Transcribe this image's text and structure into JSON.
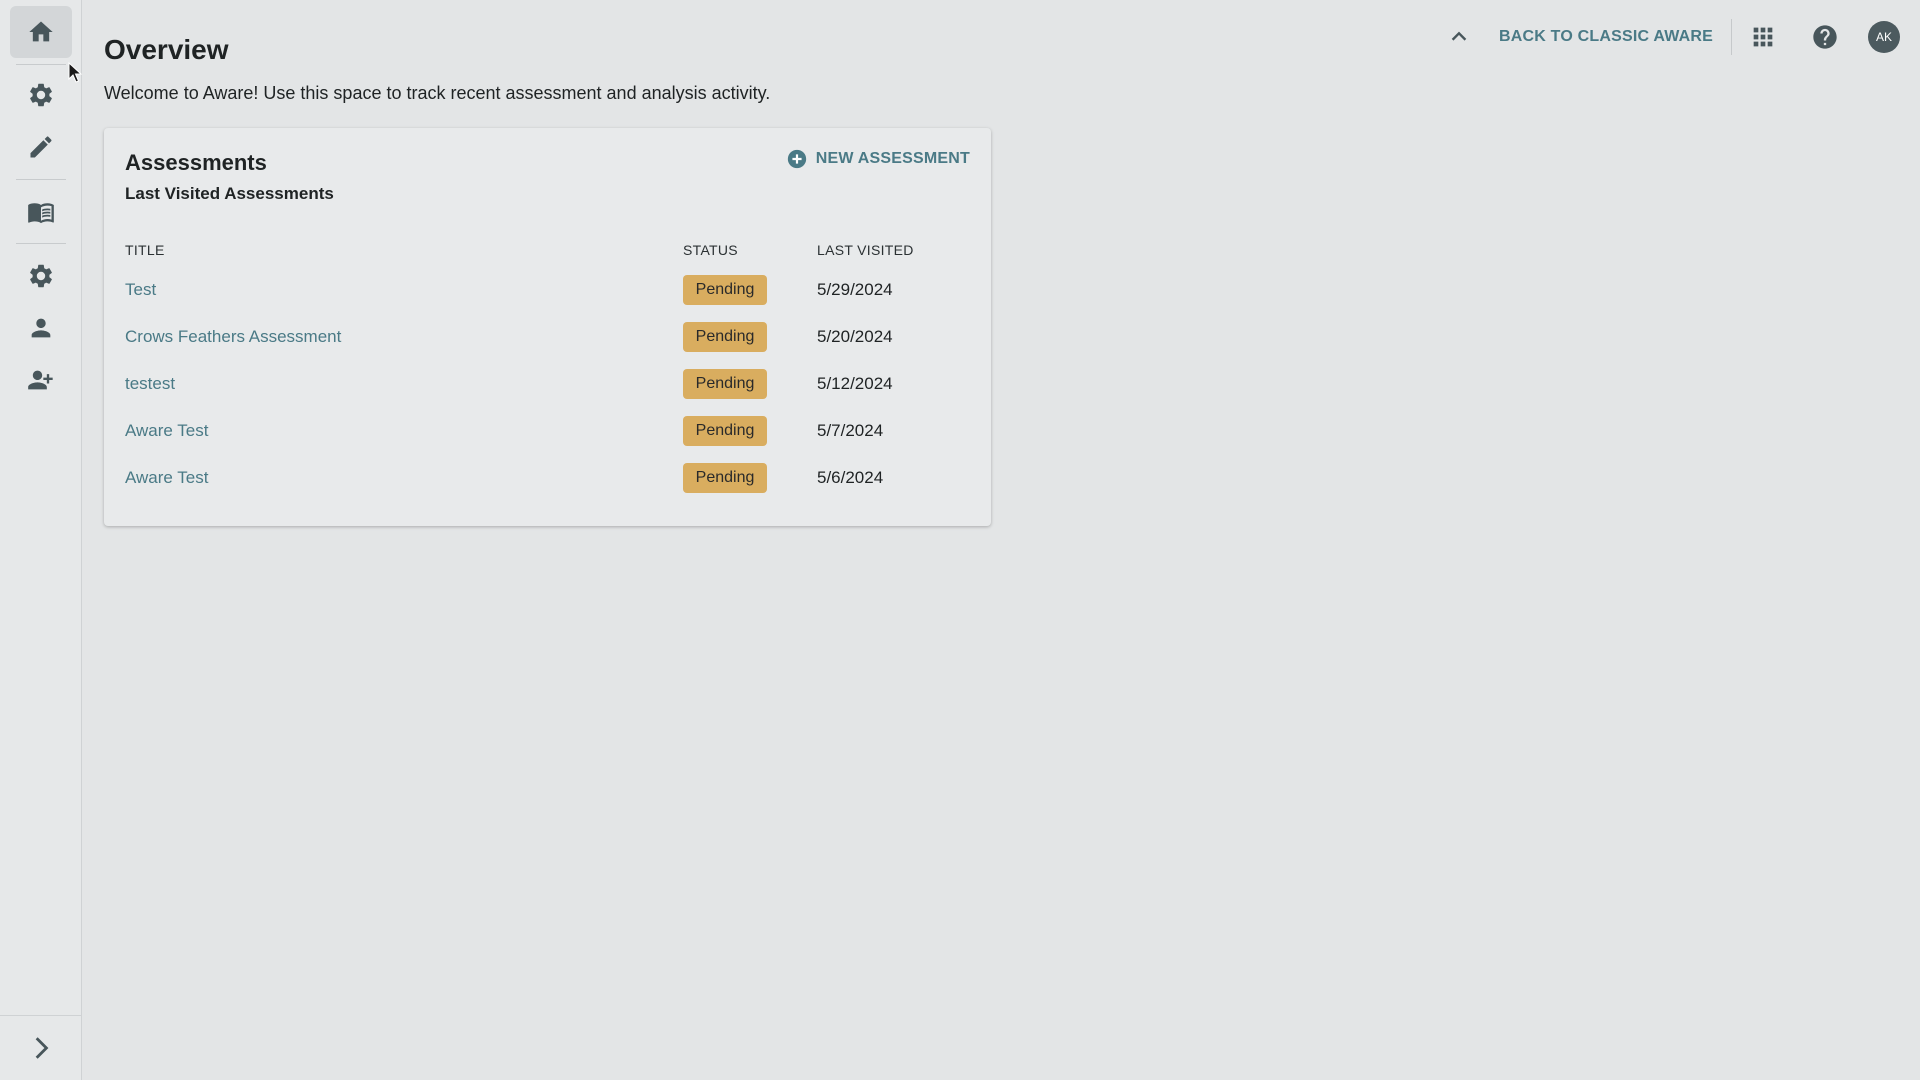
{
  "header": {
    "classic_link": "BACK TO CLASSIC AWARE",
    "avatar_initials": "AK",
    "icons": [
      "chevron-up-icon",
      "apps-grid-icon",
      "help-icon"
    ]
  },
  "sidebar": {
    "items": [
      {
        "icon": "home-icon",
        "active": true
      },
      {
        "icon": "gear-icon"
      },
      {
        "icon": "pencil-icon"
      },
      {
        "icon": "book-icon"
      },
      {
        "icon": "gear-icon"
      },
      {
        "icon": "person-icon"
      },
      {
        "icon": "person-add-icon"
      }
    ],
    "expand_icon": "chevron-right-icon"
  },
  "page": {
    "title": "Overview",
    "welcome": "Welcome to Aware! Use this space to track recent assessment and analysis activity."
  },
  "assessments": {
    "title": "Assessments",
    "subtitle": "Last Visited Assessments",
    "new_button": "NEW ASSESSMENT",
    "columns": {
      "title": "TITLE",
      "status": "STATUS",
      "last_visited": "LAST VISITED"
    },
    "rows": [
      {
        "title": "Test",
        "status": "Pending",
        "last_visited": "5/29/2024"
      },
      {
        "title": "Crows Feathers Assessment",
        "status": "Pending",
        "last_visited": "5/20/2024"
      },
      {
        "title": "testest",
        "status": "Pending",
        "last_visited": "5/12/2024"
      },
      {
        "title": "Aware Test",
        "status": "Pending",
        "last_visited": "5/7/2024"
      },
      {
        "title": "Aware Test",
        "status": "Pending",
        "last_visited": "5/6/2024"
      }
    ]
  },
  "colors": {
    "accent": "#4a7a86",
    "pending_badge": "#d9ad5f",
    "background": "#e3e5e6"
  }
}
